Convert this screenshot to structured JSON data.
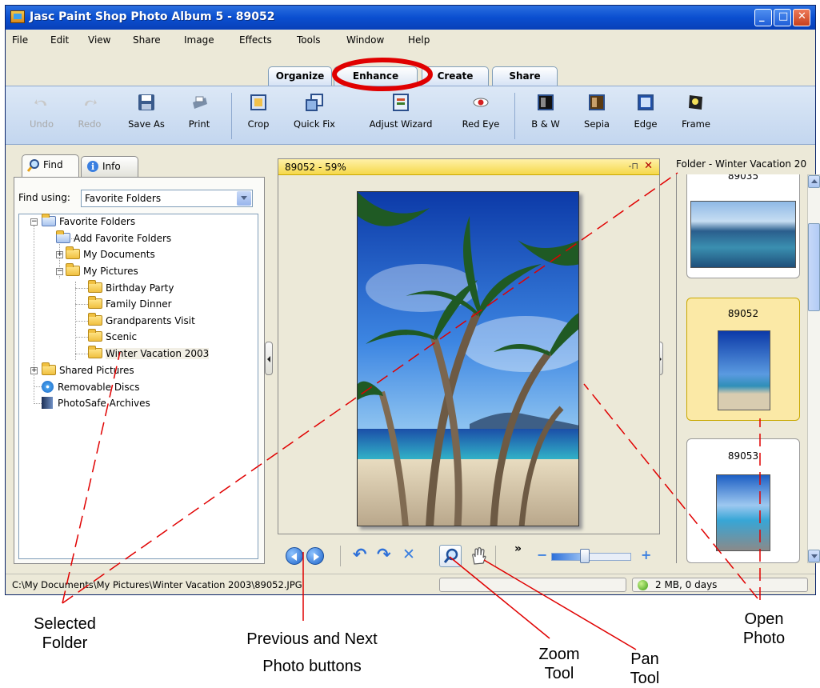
{
  "window": {
    "title": "Jasc Paint Shop Photo Album 5 - 89052"
  },
  "menu": [
    "File",
    "Edit",
    "View",
    "Share",
    "Image",
    "Effects",
    "Tools",
    "Window",
    "Help"
  ],
  "mode_tabs": [
    "Organize",
    "Enhance",
    "Create",
    "Share"
  ],
  "active_mode": "Enhance",
  "toolbar": {
    "undo": "Undo",
    "redo": "Redo",
    "save_as": "Save As",
    "print": "Print",
    "crop": "Crop",
    "quick_fix": "Quick Fix",
    "adjust_wizard": "Adjust Wizard",
    "red_eye": "Red Eye",
    "bw": "B & W",
    "sepia": "Sepia",
    "edge": "Edge",
    "frame": "Frame"
  },
  "left_panel": {
    "tabs": [
      "Find",
      "Info"
    ],
    "find_using_label": "Find using:",
    "find_using_value": "Favorite Folders",
    "tree": {
      "favorite_folders": "Favorite Folders",
      "add_favorite": "Add Favorite Folders",
      "my_documents": "My Documents",
      "my_pictures": "My Pictures",
      "birthday": "Birthday Party",
      "family_dinner": "Family Dinner",
      "grandparents": "Grandparents Visit",
      "scenic": "Scenic",
      "winter": "Winter Vacation 2003",
      "shared_pictures": "Shared Pictures",
      "removable": "Removable Discs",
      "photosafe": "PhotoSafe Archives"
    }
  },
  "viewer": {
    "header": "89052 - 59%",
    "pin": "-⊓",
    "close": "✕"
  },
  "right_panel": {
    "header": "Folder - Winter Vacation 20",
    "thumbs": [
      "89035",
      "89052",
      "89053"
    ]
  },
  "status": {
    "path": "C:\\My Documents\\My Pictures\\Winter Vacation 2003\\89052.JPG",
    "info": "2 MB, 0 days"
  },
  "annotations": {
    "selected_folder": [
      "Selected",
      "Folder"
    ],
    "prev_next": [
      "Previous and Next",
      "Photo buttons"
    ],
    "zoom": [
      "Zoom",
      "Tool"
    ],
    "pan": [
      "Pan",
      "Tool"
    ],
    "open_photo": [
      "Open",
      "Photo"
    ]
  },
  "colors": {
    "accent": "#0a4fd0",
    "annotation": "#e00000",
    "highlight": "#fbe9a6"
  }
}
